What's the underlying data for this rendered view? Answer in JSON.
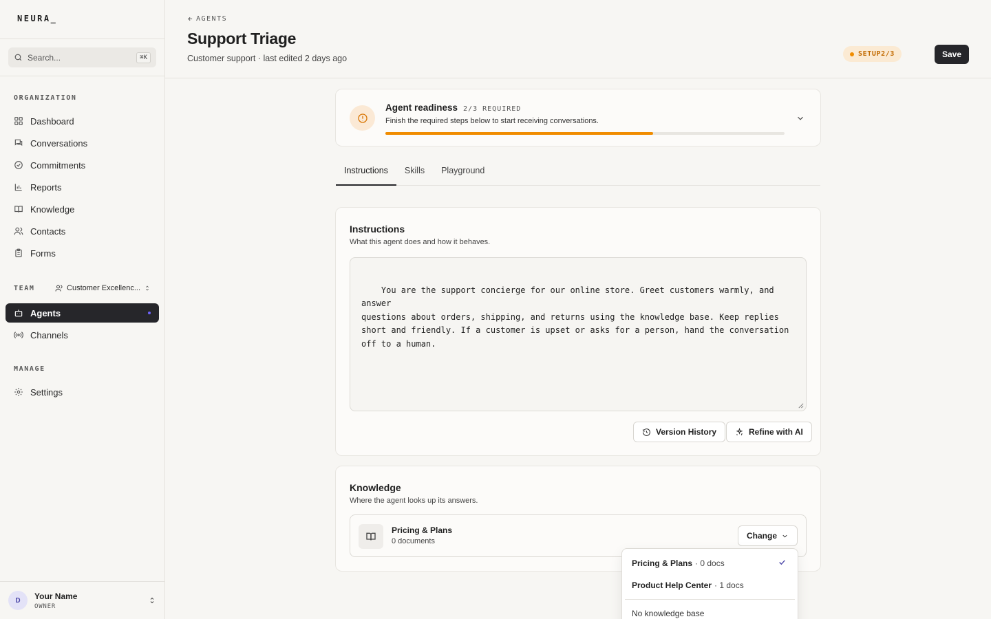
{
  "app": {
    "logo": "NEURA_"
  },
  "search": {
    "placeholder": "Search...",
    "shortcut": "⌘K"
  },
  "sidebar": {
    "org_label": "ORGANIZATION",
    "org_items": [
      {
        "label": "Dashboard",
        "icon": "grid-icon"
      },
      {
        "label": "Conversations",
        "icon": "chat-icon"
      },
      {
        "label": "Commitments",
        "icon": "check-circle-icon"
      },
      {
        "label": "Reports",
        "icon": "bar-chart-icon"
      },
      {
        "label": "Knowledge",
        "icon": "book-icon"
      },
      {
        "label": "Contacts",
        "icon": "users-icon"
      },
      {
        "label": "Forms",
        "icon": "clipboard-icon"
      }
    ],
    "team_label": "TEAM",
    "team_name": "Customer Excellenc...",
    "team_items": [
      {
        "label": "Agents",
        "icon": "bot-icon",
        "active": true
      },
      {
        "label": "Channels",
        "icon": "broadcast-icon"
      }
    ],
    "manage_label": "MANAGE",
    "manage_items": [
      {
        "label": "Settings",
        "icon": "gear-icon"
      }
    ],
    "user": {
      "initial": "D",
      "name": "Your Name",
      "role": "OWNER"
    }
  },
  "header": {
    "breadcrumb": "AGENTS",
    "title": "Support Triage",
    "subtitle": "Customer support · last edited 2 days ago",
    "setup_badge": "SETUP2/3",
    "save_label": "Save"
  },
  "readiness": {
    "title": "Agent readiness",
    "required": "2/3 REQUIRED",
    "description": "Finish the required steps below to start receiving conversations.",
    "progress": 0.67,
    "accent": "#f08c00"
  },
  "tabs": [
    {
      "label": "Instructions",
      "active": true
    },
    {
      "label": "Skills",
      "active": false
    },
    {
      "label": "Playground",
      "active": false
    }
  ],
  "instructions": {
    "title": "Instructions",
    "description": "What this agent does and how it behaves.",
    "text": "You are the support concierge for our online store. Greet customers warmly, and answer\nquestions about orders, shipping, and returns using the knowledge base. Keep replies\nshort and friendly. If a customer is upset or asks for a person, hand the conversation\noff to a human.",
    "version_history_label": "Version History",
    "refine_label": "Refine with AI"
  },
  "knowledge": {
    "title": "Knowledge",
    "description": "Where the agent looks up its answers.",
    "selected_name": "Pricing & Plans",
    "selected_count": "0 documents",
    "change_label": "Change",
    "dropdown": {
      "options": [
        {
          "name": "Pricing & Plans",
          "count": "· 0 docs",
          "selected": true
        },
        {
          "name": "Product Help Center",
          "count": "· 1 docs",
          "selected": false
        }
      ],
      "none_label": "No knowledge base"
    }
  }
}
